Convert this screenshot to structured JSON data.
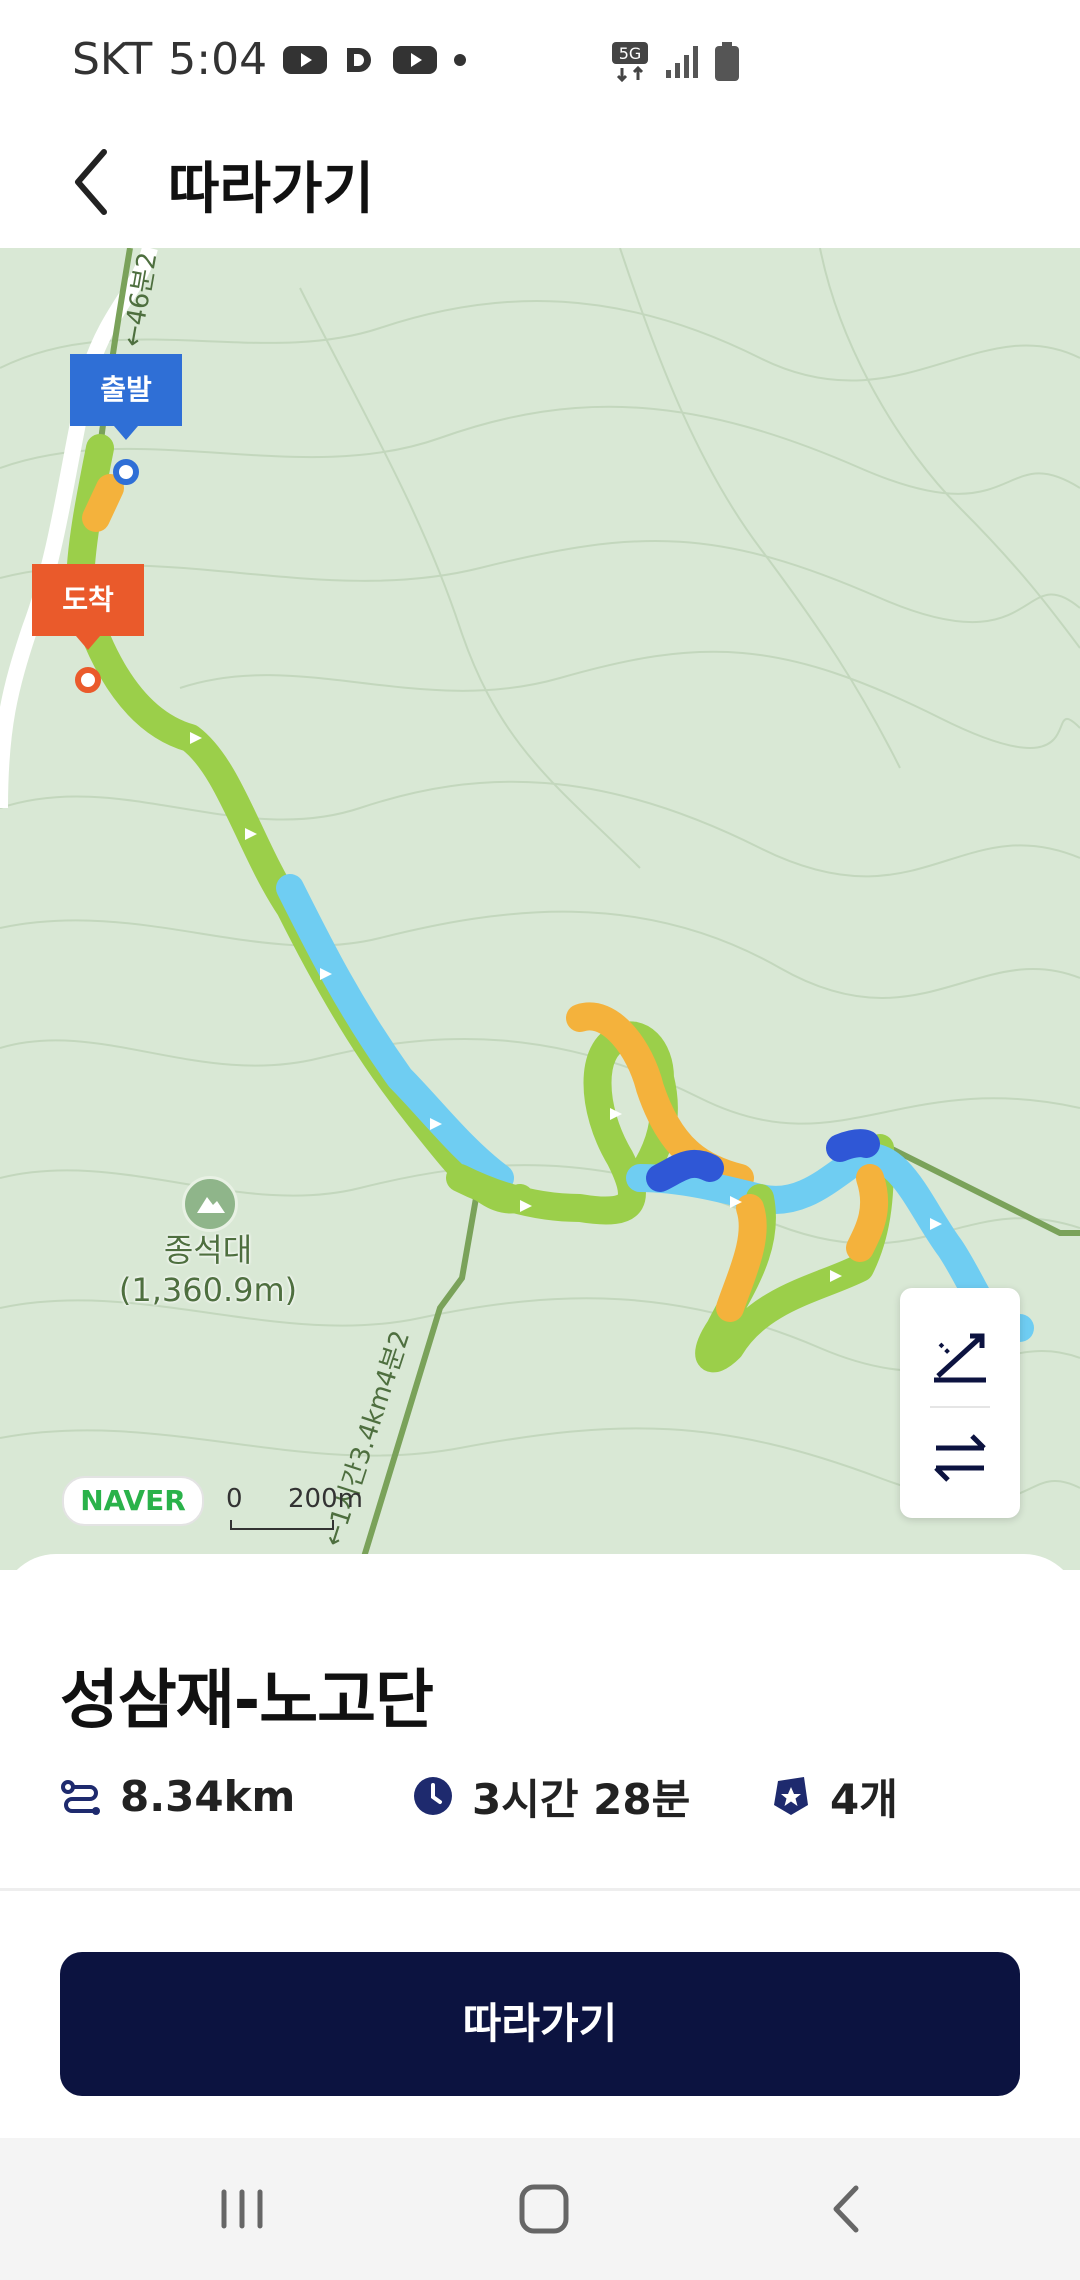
{
  "status_bar": {
    "carrier": "SKT",
    "time": "5:04",
    "network": "5G"
  },
  "header": {
    "title": "따라가기"
  },
  "map": {
    "start_label": "출발",
    "end_label": "도착",
    "peak_name": "종석대",
    "peak_elevation": "(1,360.9m)",
    "trail_label_top": "←46분2",
    "trail_label_bottom": "←1시간3.4km4분2",
    "provider": "NAVER",
    "scale_zero": "0",
    "scale_distance": "200m"
  },
  "route": {
    "name": "성삼재-노고단",
    "distance": "8.34km",
    "duration": "3시간 28분",
    "count": "4개"
  },
  "actions": {
    "follow_button": "따라가기"
  },
  "colors": {
    "primary": "#0c1340",
    "start": "#2f6fd6",
    "end": "#ea5a2b",
    "route_green": "#9bcf4a",
    "route_blue": "#6fcdf2",
    "route_orange": "#f4b23c",
    "map_bg": "#d9e8d5"
  }
}
